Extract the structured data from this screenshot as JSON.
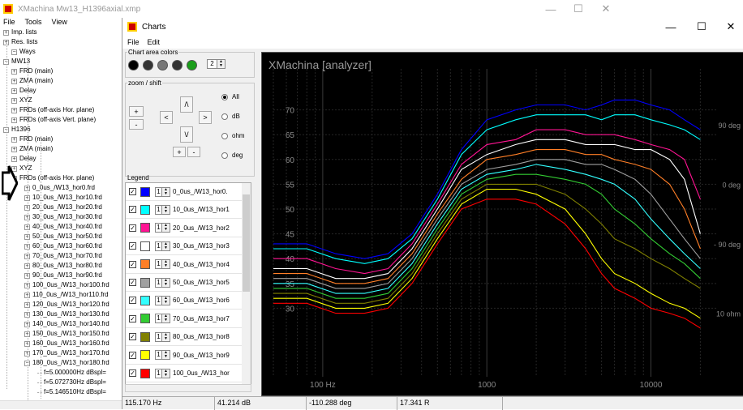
{
  "main_window": {
    "title": "XMachina Mw13_H1396axial.xmp",
    "menu": [
      "File",
      "Tools",
      "View"
    ]
  },
  "tree": [
    {
      "label": "Imp. lists",
      "level": 1
    },
    {
      "label": "Res. lists",
      "level": 1
    },
    {
      "label": "Ways",
      "level": 0
    },
    {
      "label": "MW13",
      "level": 1
    },
    {
      "label": "FRD (main)",
      "level": 2
    },
    {
      "label": "ZMA (main)",
      "level": 2
    },
    {
      "label": "Delay",
      "level": 2
    },
    {
      "label": "XYZ",
      "level": 2
    },
    {
      "label": "FRDs (off-axis Hor. plane)",
      "level": 2
    },
    {
      "label": "FRDs (off-axis Vert. plane)",
      "level": 2
    },
    {
      "label": "H1396",
      "level": 1
    },
    {
      "label": "FRD (main)",
      "level": 2
    },
    {
      "label": "ZMA (main)",
      "level": 2
    },
    {
      "label": "Delay",
      "level": 2
    },
    {
      "label": "XYZ",
      "level": 2
    },
    {
      "label": "FRDs (off-axis Hor. plane)",
      "level": 2
    },
    {
      "label": "0_0us_/W13_hor0.frd",
      "level": 3
    },
    {
      "label": "10_0us_/W13_hor10.frd",
      "level": 3
    },
    {
      "label": "20_0us_/W13_hor20.frd",
      "level": 3
    },
    {
      "label": "30_0us_/W13_hor30.frd",
      "level": 3
    },
    {
      "label": "40_0us_/W13_hor40.frd",
      "level": 3
    },
    {
      "label": "50_0us_/W13_hor50.frd",
      "level": 3
    },
    {
      "label": "60_0us_/W13_hor60.frd",
      "level": 3
    },
    {
      "label": "70_0us_/W13_hor70.frd",
      "level": 3
    },
    {
      "label": "80_0us_/W13_hor80.frd",
      "level": 3
    },
    {
      "label": "90_0us_/W13_hor90.frd",
      "level": 3
    },
    {
      "label": "100_0us_/W13_hor100.frd",
      "level": 3
    },
    {
      "label": "110_0us_/W13_hor110.frd",
      "level": 3
    },
    {
      "label": "120_0us_/W13_hor120.frd",
      "level": 3
    },
    {
      "label": "130_0us_/W13_hor130.frd",
      "level": 3
    },
    {
      "label": "140_0us_/W13_hor140.frd",
      "level": 3
    },
    {
      "label": "150_0us_/W13_hor150.frd",
      "level": 3
    },
    {
      "label": "160_0us_/W13_hor160.frd",
      "level": 3
    },
    {
      "label": "170_0us_/W13_hor170.frd",
      "level": 3
    },
    {
      "label": "180_0us_/W13_hor180.frd",
      "level": 3
    },
    {
      "label": "f=5.000000Hz dBspl=",
      "level": 4
    },
    {
      "label": "f=5.072730Hz dBspl=",
      "level": 4
    },
    {
      "label": "f=5.146510Hz dBspl=",
      "level": 4
    }
  ],
  "charts_window": {
    "title": "Charts",
    "menu": [
      "File",
      "Edit"
    ],
    "chart_area_colors": {
      "label": "Chart area colors",
      "swatches": [
        "#000000",
        "#333333",
        "#777777",
        "#333333",
        "#1a9e1a"
      ],
      "count": "2"
    },
    "zoom_shift": {
      "label": "zoom / shift",
      "buttons": {
        "up": "/\\",
        "down": "\\/",
        "left": "<",
        "right": ">",
        "plus": "+",
        "minus": "-"
      },
      "radios": [
        {
          "label": "All",
          "checked": true
        },
        {
          "label": "dB",
          "checked": false
        },
        {
          "label": "ohm",
          "checked": false
        },
        {
          "label": "deg",
          "checked": false
        }
      ]
    },
    "legend": {
      "label": "Legend",
      "items": [
        {
          "name": "0_0us_/W13_hor0.",
          "color": "#0000ff",
          "width": "1"
        },
        {
          "name": "10_0us_/W13_hor1",
          "color": "#00ffff",
          "width": "1"
        },
        {
          "name": "20_0us_/W13_hor2",
          "color": "#ff1493",
          "width": "1"
        },
        {
          "name": "30_0us_/W13_hor3",
          "color": "#ffffff",
          "width": "1"
        },
        {
          "name": "40_0us_/W13_hor4",
          "color": "#ff7f27",
          "width": "1"
        },
        {
          "name": "50_0us_/W13_hor5",
          "color": "#a0a0a0",
          "width": "1"
        },
        {
          "name": "60_0us_/W13_hor6",
          "color": "#33ffff",
          "width": "1"
        },
        {
          "name": "70_0us_/W13_hor7",
          "color": "#33cc33",
          "width": "1"
        },
        {
          "name": "80_0us_/W13_hor8",
          "color": "#808000",
          "width": "1"
        },
        {
          "name": "90_0us_/W13_hor9",
          "color": "#ffff00",
          "width": "1"
        },
        {
          "name": "100_0us_/W13_hor",
          "color": "#ff0000",
          "width": "1"
        }
      ]
    },
    "status": [
      "115.170 Hz",
      "41.214 dB",
      "-110.288 deg",
      "17.341 R"
    ]
  },
  "chart_data": {
    "type": "line",
    "title": "XMachina  [analyzer]",
    "xscale": "log",
    "xlim": [
      50,
      25000
    ],
    "ylim": [
      17,
      75
    ],
    "x_tick_labels": [
      "100 Hz",
      "1000",
      "10000"
    ],
    "y_tick_labels": [
      "70",
      "65",
      "60",
      "55",
      "50",
      "45",
      "40",
      "35",
      "30"
    ],
    "right_axis_labels": [
      "90 deg",
      "0 deg",
      "- 90 deg",
      "10 ohm"
    ],
    "right_axis_values": [
      67,
      55,
      43,
      29
    ],
    "x": [
      50,
      80,
      120,
      180,
      250,
      350,
      500,
      700,
      1000,
      1500,
      2000,
      3000,
      4000,
      5000,
      6000,
      8000,
      10000,
      13000,
      16000,
      20000
    ],
    "series": [
      {
        "color": "#0000ff",
        "values": [
          43,
          43,
          41,
          40,
          41,
          45,
          53,
          62,
          68,
          70,
          71,
          71,
          70,
          71,
          72,
          72,
          71,
          70,
          68,
          66
        ]
      },
      {
        "color": "#00ffff",
        "values": [
          42,
          42,
          40,
          39,
          40,
          44,
          52,
          61,
          66,
          68,
          69,
          69,
          69,
          68,
          69,
          69,
          68,
          67,
          66,
          64
        ]
      },
      {
        "color": "#ff1493",
        "values": [
          40,
          40,
          38,
          37,
          38,
          43,
          51,
          59,
          63,
          64,
          66,
          66,
          65,
          65,
          65,
          64,
          63,
          62,
          60,
          52
        ]
      },
      {
        "color": "#ffffff",
        "values": [
          38,
          38,
          36,
          36,
          37,
          42,
          50,
          58,
          61,
          63,
          64,
          64,
          63,
          63,
          63,
          62,
          62,
          60,
          56,
          45
        ]
      },
      {
        "color": "#ff7f27",
        "values": [
          37,
          37,
          35,
          35,
          36,
          41,
          49,
          56,
          60,
          61,
          62,
          62,
          61,
          61,
          60,
          59,
          58,
          55,
          50,
          42
        ]
      },
      {
        "color": "#a0a0a0",
        "values": [
          36,
          36,
          34,
          34,
          35,
          40,
          48,
          55,
          58,
          59,
          60,
          60,
          59,
          59,
          58,
          56,
          53,
          48,
          44,
          40
        ]
      },
      {
        "color": "#33ffff",
        "values": [
          35,
          35,
          33,
          33,
          34,
          39,
          47,
          54,
          57,
          58,
          59,
          58,
          57,
          56,
          55,
          52,
          48,
          44,
          41,
          38
        ]
      },
      {
        "color": "#33cc33",
        "values": [
          34,
          34,
          32,
          32,
          33,
          38,
          46,
          53,
          56,
          57,
          57,
          56,
          55,
          53,
          50,
          47,
          44,
          41,
          39,
          36
        ]
      },
      {
        "color": "#808000",
        "values": [
          33,
          33,
          31,
          31,
          32,
          37,
          45,
          52,
          55,
          55,
          55,
          53,
          50,
          47,
          44,
          42,
          40,
          38,
          36,
          34
        ]
      },
      {
        "color": "#ffff00",
        "values": [
          32,
          32,
          30,
          30,
          31,
          36,
          44,
          51,
          54,
          54,
          53,
          50,
          45,
          40,
          37,
          35,
          33,
          31,
          30,
          28
        ]
      },
      {
        "color": "#ff0000",
        "values": [
          31,
          31,
          29,
          29,
          30,
          35,
          43,
          50,
          52,
          52,
          51,
          47,
          42,
          37,
          34,
          32,
          30,
          29,
          28,
          26
        ]
      }
    ]
  }
}
